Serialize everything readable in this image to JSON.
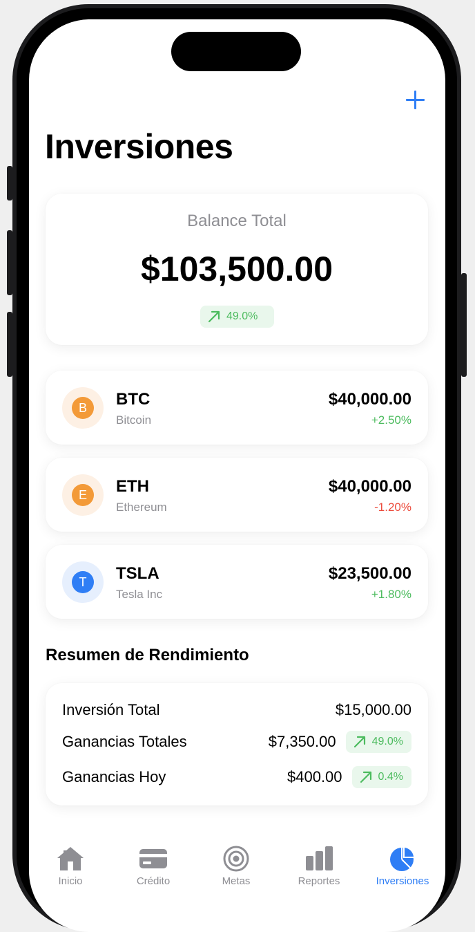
{
  "header": {
    "title": "Inversiones",
    "add_icon": "plus-icon"
  },
  "balance": {
    "label": "Balance Total",
    "value": "$103,500.00",
    "change": "49.0%",
    "trend_icon": "arrow-up-right-icon"
  },
  "assets": [
    {
      "symbol": "BTC",
      "name": "Bitcoin",
      "value": "$40,000.00",
      "change": "+2.50%",
      "icon_letter": "B",
      "icon_name": "bitcoin-icon",
      "color": "#f39a38",
      "bg": "#fdf0e4",
      "trend": "positive"
    },
    {
      "symbol": "ETH",
      "name": "Ethereum",
      "value": "$40,000.00",
      "change": "-1.20%",
      "icon_letter": "E",
      "icon_name": "ethereum-icon",
      "color": "#f39a38",
      "bg": "#fdf0e4",
      "trend": "negative"
    },
    {
      "symbol": "TSLA",
      "name": "Tesla Inc",
      "value": "$23,500.00",
      "change": "+1.80%",
      "icon_letter": "T",
      "icon_name": "tesla-icon",
      "color": "#2f7ef5",
      "bg": "#e6effd",
      "trend": "positive"
    }
  ],
  "summary": {
    "title": "Resumen de Rendimiento",
    "rows": [
      {
        "label": "Inversión Total",
        "value": "$15,000.00",
        "change": ""
      },
      {
        "label": "Ganancias Totales",
        "value": "$7,350.00",
        "change": "49.0%"
      },
      {
        "label": "Ganancias Hoy",
        "value": "$400.00",
        "change": "0.4%"
      }
    ]
  },
  "tabs": [
    {
      "label": "Inicio",
      "icon": "house-icon",
      "active": false
    },
    {
      "label": "Crédito",
      "icon": "credit-card-icon",
      "active": false
    },
    {
      "label": "Metas",
      "icon": "target-icon",
      "active": false
    },
    {
      "label": "Reportes",
      "icon": "bar-chart-icon",
      "active": false
    },
    {
      "label": "Inversiones",
      "icon": "pie-chart-icon",
      "active": true
    }
  ],
  "colors": {
    "accent": "#2f7ef5",
    "positive": "#4cbb5e",
    "negative": "#ec4b3c",
    "secondary_text": "#8e8e93"
  }
}
